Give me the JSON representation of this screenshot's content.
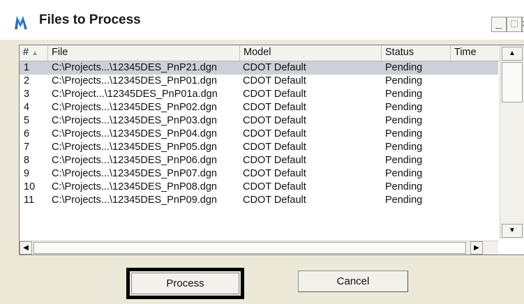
{
  "window": {
    "title": "Files to Process",
    "controls": {
      "minimize": "_",
      "maximize": "□",
      "close": "×"
    }
  },
  "table": {
    "columns": [
      {
        "label": "#",
        "sort_indicator": "▲"
      },
      {
        "label": "File"
      },
      {
        "label": "Model"
      },
      {
        "label": "Status"
      },
      {
        "label": "Time"
      }
    ],
    "rows": [
      {
        "num": "1",
        "file": "C:\\Projects...\\12345DES_PnP21.dgn",
        "model": "CDOT Default",
        "status": "Pending",
        "time": ""
      },
      {
        "num": "2",
        "file": "C:\\Projects...\\12345DES_PnP01.dgn",
        "model": "CDOT Default",
        "status": "Pending",
        "time": ""
      },
      {
        "num": "3",
        "file": "C:\\Project...\\12345DES_PnP01a.dgn",
        "model": "CDOT Default",
        "status": "Pending",
        "time": ""
      },
      {
        "num": "4",
        "file": "C:\\Projects...\\12345DES_PnP02.dgn",
        "model": "CDOT Default",
        "status": "Pending",
        "time": ""
      },
      {
        "num": "5",
        "file": "C:\\Projects...\\12345DES_PnP03.dgn",
        "model": "CDOT Default",
        "status": "Pending",
        "time": ""
      },
      {
        "num": "6",
        "file": "C:\\Projects...\\12345DES_PnP04.dgn",
        "model": "CDOT Default",
        "status": "Pending",
        "time": ""
      },
      {
        "num": "7",
        "file": "C:\\Projects...\\12345DES_PnP05.dgn",
        "model": "CDOT Default",
        "status": "Pending",
        "time": ""
      },
      {
        "num": "8",
        "file": "C:\\Projects...\\12345DES_PnP06.dgn",
        "model": "CDOT Default",
        "status": "Pending",
        "time": ""
      },
      {
        "num": "9",
        "file": "C:\\Projects...\\12345DES_PnP07.dgn",
        "model": "CDOT Default",
        "status": "Pending",
        "time": ""
      },
      {
        "num": "10",
        "file": "C:\\Projects...\\12345DES_PnP08.dgn",
        "model": "CDOT Default",
        "status": "Pending",
        "time": ""
      },
      {
        "num": "11",
        "file": "C:\\Projects...\\12345DES_PnP09.dgn",
        "model": "CDOT Default",
        "status": "Pending",
        "time": ""
      }
    ],
    "selected_row": 1
  },
  "scroll": {
    "up": "▲",
    "down": "▼",
    "left": "◀",
    "right": "▶"
  },
  "buttons": {
    "process": "Process",
    "cancel": "Cancel"
  },
  "colors": {
    "selection": "#cdd0d7",
    "dialog_bg": "#ece9d8",
    "icon": "#2a6fc9"
  }
}
